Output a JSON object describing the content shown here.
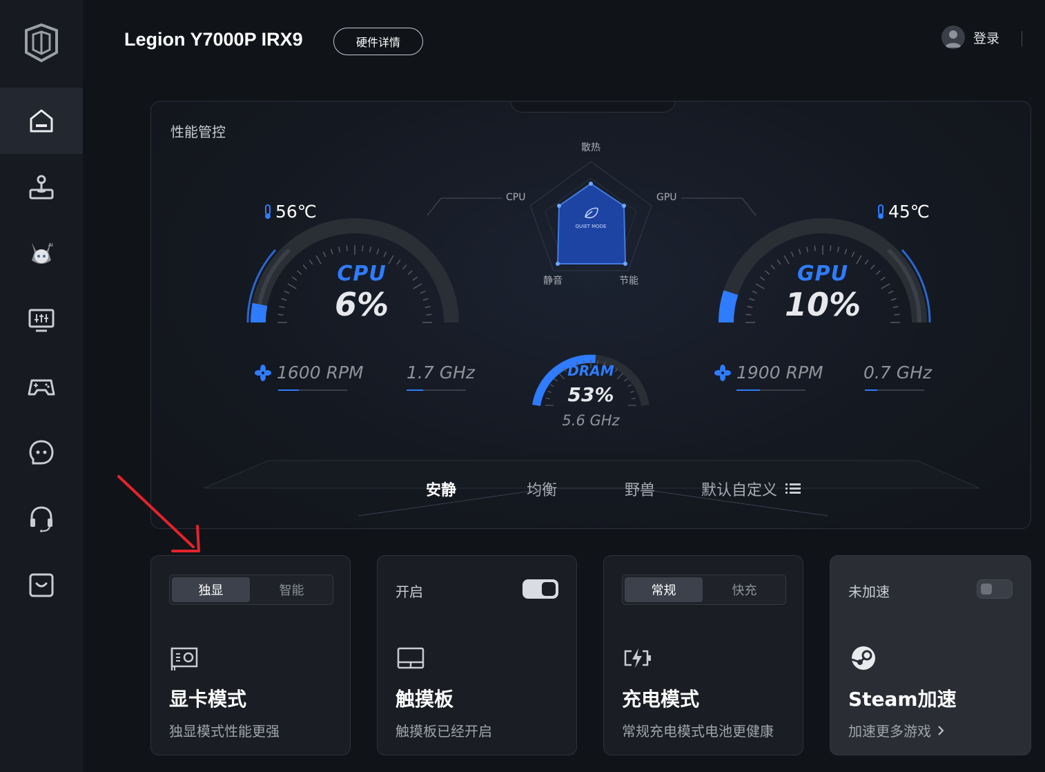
{
  "header": {
    "device_name": "Legion Y7000P IRX9",
    "hardware_details_label": "硬件详情",
    "login_label": "登录"
  },
  "sidebar": {
    "items": [
      {
        "icon": "home-icon",
        "active": true
      },
      {
        "icon": "joystick-icon",
        "active": false
      },
      {
        "icon": "ai-assistant-avatar-icon",
        "active": false
      },
      {
        "icon": "monitor-settings-icon",
        "active": false
      },
      {
        "icon": "gamepad-icon",
        "active": false
      },
      {
        "icon": "chat-bot-icon",
        "active": false
      },
      {
        "icon": "headset-icon",
        "active": false
      },
      {
        "icon": "store-bag-icon",
        "active": false
      }
    ]
  },
  "performance": {
    "title": "性能管控",
    "cpu": {
      "name": "CPU",
      "usage": "6%",
      "usage_level": 0.06,
      "temperature": "56℃",
      "fan": "1600 RPM",
      "freq": "1.7 GHz"
    },
    "gpu": {
      "name": "GPU",
      "usage": "10%",
      "usage_level": 0.1,
      "temperature": "45℃",
      "fan": "1900 RPM",
      "freq": "0.7 GHz"
    },
    "dram": {
      "name": "DRAM",
      "usage": "53%",
      "usage_level": 0.53,
      "freq": "5.6 GHz"
    },
    "radar": {
      "labels": {
        "top": "散热",
        "left": "CPU",
        "right": "GPU",
        "bottom_left": "静音",
        "bottom_right": "节能"
      },
      "center_label": "QUIET MODE"
    },
    "modes": [
      {
        "label": "安静",
        "active": true
      },
      {
        "label": "均衡",
        "active": false
      },
      {
        "label": "野兽",
        "active": false
      },
      {
        "label": "默认自定义",
        "active": false
      }
    ]
  },
  "cards": {
    "gpu_mode": {
      "options": [
        "独显",
        "智能"
      ],
      "selected": "独显",
      "title": "显卡模式",
      "description": "独显模式性能更强"
    },
    "touchpad": {
      "toggle_label": "开启",
      "toggle_on": true,
      "title": "触摸板",
      "description": "触摸板已经开启"
    },
    "charging": {
      "options": [
        "常规",
        "快充"
      ],
      "selected": "常规",
      "title": "充电模式",
      "description": "常规充电模式电池更健康"
    },
    "steam": {
      "toggle_label": "未加速",
      "toggle_on": false,
      "title": "Steam加速",
      "description": "加速更多游戏"
    }
  },
  "colors": {
    "accent_blue": "#2f7cff",
    "background": "#101318",
    "annotation_red": "#e5232b"
  }
}
